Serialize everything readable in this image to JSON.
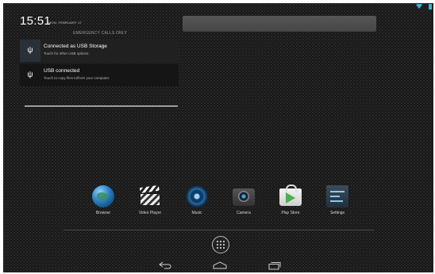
{
  "status": {
    "time": "15:51",
    "date": "MON, FEBRUARY 17",
    "emergency": "EMERGENCY CALLS ONLY"
  },
  "notifications": [
    {
      "icon": "usb-icon",
      "title": "Connected as USB Storage",
      "subtitle": "Touch for other USB options."
    },
    {
      "icon": "usb-icon",
      "title": "USB connected",
      "subtitle": "Touch to copy files to/from your computer."
    }
  ],
  "dock": {
    "apps": [
      {
        "label": "Browser",
        "icon": "globe-icon"
      },
      {
        "label": "Video Player",
        "icon": "clapperboard-icon"
      },
      {
        "label": "Music",
        "icon": "speaker-icon"
      },
      {
        "label": "Camera",
        "icon": "camera-icon"
      },
      {
        "label": "Play Store",
        "icon": "shopping-bag-icon"
      },
      {
        "label": "Settings",
        "icon": "sliders-icon"
      }
    ]
  },
  "navigation": {
    "buttons": [
      "back-icon",
      "home-icon",
      "recent-apps-icon"
    ]
  },
  "colors": {
    "accent": "#33b5e5",
    "background": "#151515"
  }
}
